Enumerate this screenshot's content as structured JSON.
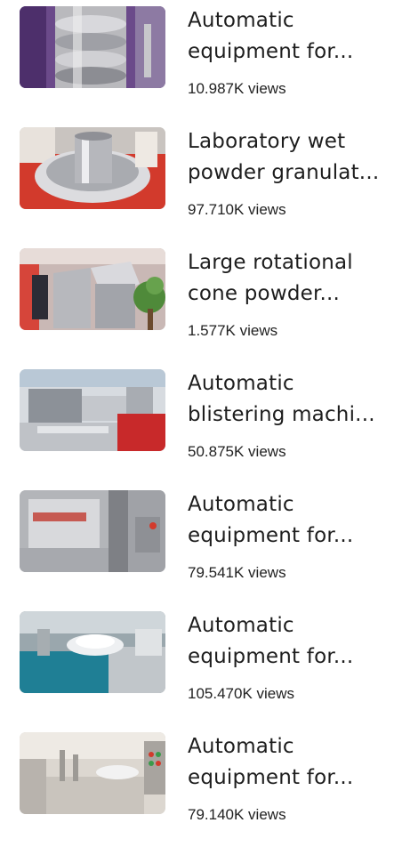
{
  "items": [
    {
      "title": "Automatic equipment for...",
      "views": "10.987K views",
      "thumb_icon": "machine-photo-cylinder"
    },
    {
      "title": "Laboratory wet powder granulat...",
      "views": "97.710K views",
      "thumb_icon": "machine-photo-granulator"
    },
    {
      "title": "Large rotational cone powder...",
      "views": "1.577K views",
      "thumb_icon": "machine-photo-cone-mixer"
    },
    {
      "title": "Automatic blistering machi...",
      "views": "50.875K views",
      "thumb_icon": "machine-photo-blister"
    },
    {
      "title": "Automatic equipment for...",
      "views": "79.541K views",
      "thumb_icon": "machine-photo-steel-cabinet"
    },
    {
      "title": "Automatic equipment for...",
      "views": "105.470K views",
      "thumb_icon": "machine-photo-bottle-filler"
    },
    {
      "title": "Automatic equipment for...",
      "views": "79.140K views",
      "thumb_icon": "machine-photo-filling-line"
    }
  ]
}
